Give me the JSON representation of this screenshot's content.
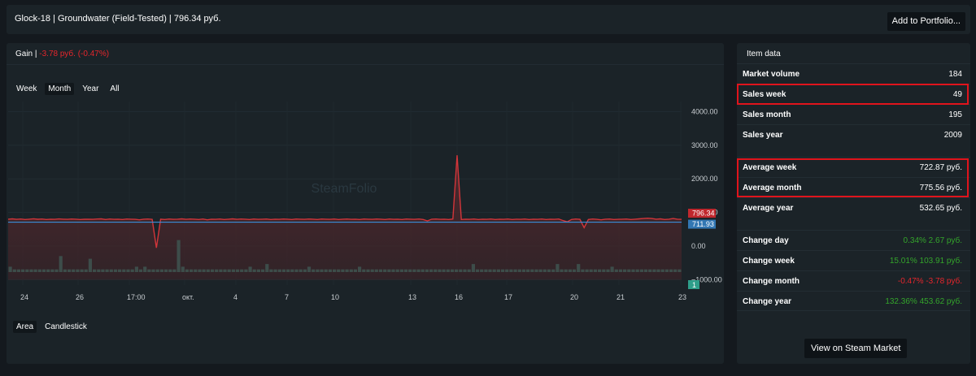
{
  "header": {
    "title": "Glock-18 | Groundwater (Field-Tested) | 796.34 руб.",
    "add_button": "Add to Portfolio..."
  },
  "gain": {
    "label": "Gain |",
    "value": "-3.78 руб. (-0.47%)"
  },
  "periods": [
    "Week",
    "Month",
    "Year",
    "All"
  ],
  "active_period": "Month",
  "chart_types": [
    "Area",
    "Candlestick"
  ],
  "colors": {
    "price_line": "#d3353a",
    "average_line": "#3a8fd9",
    "volume_bar": "#3d4d4a",
    "positive": "#34a52b",
    "negative": "#e5262c",
    "highlight": "#e0141c"
  },
  "chart_data": {
    "type": "area",
    "watermark": "SteamFolio",
    "y_ticks": [
      "4000.00",
      "3000.00",
      "2000.00",
      "1000.00",
      "0.00",
      "−1000.00"
    ],
    "x_ticks": [
      "24",
      "26",
      "17:00",
      "окт.",
      "4",
      "7",
      "10",
      "13",
      "16",
      "17",
      "20",
      "21",
      "23"
    ],
    "ylim": [
      -1400,
      4300
    ],
    "price_series": [
      800,
      810,
      795,
      805,
      790,
      800,
      812,
      798,
      805,
      790,
      800,
      795,
      808,
      800,
      795,
      805,
      800,
      790,
      798,
      800,
      795,
      805,
      810,
      790,
      805,
      795,
      800,
      790,
      805,
      800,
      795,
      780,
      800,
      805,
      795,
      -50,
      800,
      790,
      805,
      795,
      800,
      810,
      795,
      805,
      800,
      790,
      805,
      780,
      800,
      795,
      805,
      790,
      800,
      810,
      795,
      805,
      800,
      790,
      805,
      795,
      800,
      805,
      790,
      800,
      795,
      805,
      800,
      790,
      805,
      800,
      795,
      805,
      800,
      790,
      805,
      800,
      795,
      805,
      790,
      800,
      805,
      795,
      800,
      790,
      805,
      800,
      795,
      805,
      800,
      790,
      805,
      795,
      800,
      790,
      805,
      800,
      795,
      805,
      790,
      750,
      800,
      805,
      795,
      800,
      790,
      805,
      2700,
      790,
      800,
      795,
      805,
      790,
      800,
      795,
      805,
      790,
      800,
      795,
      805,
      790,
      800,
      795,
      805,
      790,
      800,
      795,
      805,
      790,
      800,
      795,
      805,
      760,
      720,
      790,
      805,
      795,
      550,
      790,
      805,
      795,
      780,
      800,
      805,
      790,
      795,
      800,
      805,
      790,
      800,
      810,
      820,
      830,
      820,
      800,
      810,
      790,
      800,
      820,
      800,
      796.34
    ],
    "average_value": 711.93,
    "last_price": 796.34,
    "last_price_label": "796.34",
    "average_label": "711.93",
    "volume_label": "1",
    "volume_series": [
      2,
      1,
      1,
      1,
      1,
      1,
      1,
      1,
      1,
      1,
      1,
      1,
      6,
      1,
      1,
      1,
      1,
      1,
      1,
      5,
      1,
      1,
      1,
      1,
      1,
      1,
      1,
      1,
      1,
      1,
      2,
      1,
      2,
      1,
      1,
      1,
      1,
      1,
      1,
      1,
      12,
      2,
      1,
      1,
      1,
      1,
      1,
      1,
      1,
      1,
      1,
      1,
      1,
      1,
      1,
      1,
      1,
      2,
      1,
      1,
      1,
      3,
      1,
      1,
      1,
      1,
      1,
      1,
      1,
      1,
      1,
      2,
      1,
      1,
      1,
      1,
      1,
      1,
      1,
      1,
      1,
      1,
      1,
      2,
      1,
      1,
      1,
      1,
      1,
      1,
      1,
      1,
      1,
      1,
      1,
      1,
      1,
      1,
      1,
      1,
      1,
      1,
      1,
      1,
      1,
      1,
      1,
      1,
      1,
      1,
      3,
      1,
      1,
      1,
      1,
      1,
      1,
      1,
      1,
      1,
      1,
      1,
      1,
      1,
      1,
      1,
      1,
      1,
      1,
      1,
      3,
      1,
      1,
      1,
      1,
      3,
      1,
      1,
      1,
      1,
      1,
      1,
      1,
      2,
      1,
      1,
      1,
      1,
      1,
      1,
      1,
      1,
      1,
      1,
      1,
      1,
      1,
      1,
      1,
      1
    ],
    "grid": true
  },
  "item_data": {
    "heading": "Item data",
    "rows": [
      {
        "label": "Market volume",
        "value": "184"
      },
      {
        "label": "Sales week",
        "value": "49"
      },
      {
        "label": "Sales month",
        "value": "195"
      },
      {
        "label": "Sales year",
        "value": "2009"
      },
      {
        "label": "Average week",
        "value": "722.87 руб."
      },
      {
        "label": "Average month",
        "value": "775.56 руб."
      },
      {
        "label": "Average year",
        "value": "532.65 руб."
      },
      {
        "label": "Change day",
        "value": "0.34% 2.67 руб."
      },
      {
        "label": "Change week",
        "value": "15.01% 103.91 руб."
      },
      {
        "label": "Change month",
        "value": "-0.47% -3.78 руб."
      },
      {
        "label": "Change year",
        "value": "132.36% 453.62 руб."
      }
    ]
  },
  "steam_button": "View on Steam Market"
}
